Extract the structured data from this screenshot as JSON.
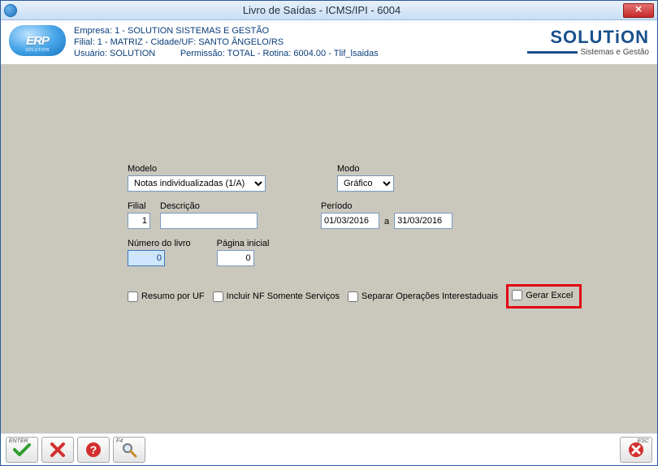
{
  "title": "Livro de Saídas - ICMS/IPI - 6004",
  "header": {
    "line1": "Empresa: 1 - SOLUTION SISTEMAS E GESTÃO",
    "line2": "Filial: 1 - MATRIZ - Cidade/UF: SANTO ÂNGELO/RS",
    "line3_user": "Usuário: SOLUTION",
    "line3_perm": "Permissão: TOTAL - Rotina: 6004.00 - Tlif_lsaidas"
  },
  "brand": {
    "name_html": "SOLUTiON",
    "sub": "Sistemas e Gestão"
  },
  "form": {
    "modelo_label": "Modelo",
    "modelo_value": "Notas individualizadas (1/A)",
    "modo_label": "Modo",
    "modo_value": "Gráfico",
    "filial_label": "Filial",
    "filial_value": "1",
    "descricao_label": "Descrição",
    "descricao_value": "",
    "periodo_label": "Período",
    "periodo_from": "01/03/2016",
    "periodo_sep": "a",
    "periodo_to": "31/03/2016",
    "numero_label": "Número do livro",
    "numero_value": "0",
    "pagina_label": "Página inicial",
    "pagina_value": "0",
    "cb_resumo": "Resumo por UF",
    "cb_incluir": "Incluir NF Somente Serviços",
    "cb_separar": "Separar Operações Interestaduais",
    "cb_excel": "Gerar Excel"
  },
  "footer": {
    "enter": "ENTER",
    "f4": "F4",
    "esc": "ESC"
  }
}
